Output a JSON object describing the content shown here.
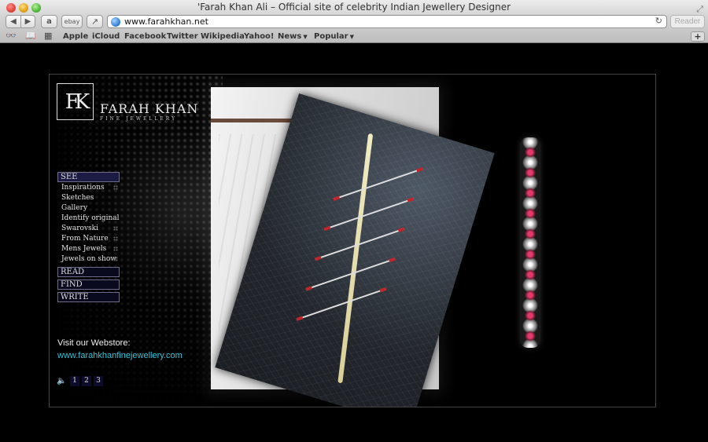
{
  "browser": {
    "window_title": "'Farah Khan Ali – Official site of celebrity Indian Jewellery Designer",
    "url": "www.farahkhan.net",
    "reader_label": "Reader",
    "toolbar": {
      "back_icon": "back-arrow-icon",
      "forward_icon": "forward-arrow-icon",
      "amazon_label": "a",
      "ebay_label": "ebay",
      "share_icon": "share-icon"
    },
    "bookmarks": [
      {
        "label": "Apple"
      },
      {
        "label": "iCloud"
      },
      {
        "label": "Facebook"
      },
      {
        "label": "Twitter"
      },
      {
        "label": "Wikipedia"
      },
      {
        "label": "Yahoo!"
      },
      {
        "label": "News"
      },
      {
        "label": "Popular"
      }
    ]
  },
  "site": {
    "brand": {
      "name": "FARAH KHAN",
      "tagline": "FINE JEWELLERY"
    },
    "menu": {
      "see": "SEE",
      "see_items": [
        "Inspirations",
        "Sketches",
        "Gallery",
        "Identify original",
        "Swarovski",
        "From Nature",
        "Mens Jewels",
        "Jewels on show"
      ],
      "read": "READ",
      "find": "FIND",
      "write": "WRITE"
    },
    "webstore": {
      "label": "Visit our Webstore:",
      "link": "www.farahkhanfinejewellery.com"
    },
    "slides": [
      "1",
      "2",
      "3"
    ],
    "colors": {
      "link": "#2ec6dd",
      "menu_active": "#1b1b44"
    }
  }
}
